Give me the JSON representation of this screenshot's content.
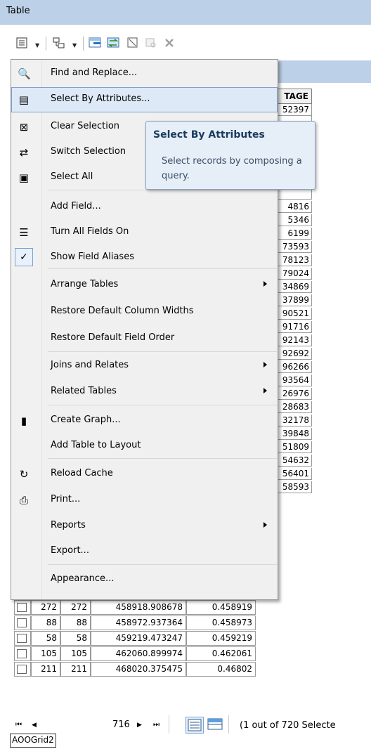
{
  "window": {
    "title": "Table"
  },
  "toolbar": {
    "icons": [
      "table-options-icon",
      "related-tables-icon",
      "select-by-attributes-icon",
      "switch-selection-icon",
      "clear-selection-icon",
      "zoom-to-selected-icon",
      "delete-selected-icon"
    ]
  },
  "table": {
    "header_partial": "TAGE",
    "partial_values": [
      "52397",
      "",
      "",
      "",
      "",
      "",
      "",
      "",
      "4816",
      "5346",
      "6199",
      "73593",
      "78123",
      "79024",
      "34869",
      "37899",
      "90521",
      "91716",
      "92143",
      "92692",
      "96266",
      "93564",
      "26976",
      "28683",
      "32178",
      "39848",
      "51809",
      "54632",
      "56401",
      "58593"
    ],
    "rows": [
      {
        "a": "272",
        "b": "272",
        "c": "458918.908678",
        "d": "0.458919"
      },
      {
        "a": "88",
        "b": "88",
        "c": "458972.937364",
        "d": "0.458973"
      },
      {
        "a": "58",
        "b": "58",
        "c": "459219.473247",
        "d": "0.459219"
      },
      {
        "a": "105",
        "b": "105",
        "c": "462060.899974",
        "d": "0.462061"
      },
      {
        "a": "211",
        "b": "211",
        "c": "468020.375475",
        "d": "0.46802"
      }
    ]
  },
  "menu": {
    "items": [
      {
        "label": "Find and Replace...",
        "icon": "binoculars-icon",
        "glyph": "🔍"
      },
      {
        "label": "Select By Attributes...",
        "icon": "select-by-attributes-icon",
        "glyph": "▤",
        "highlighted": true
      },
      {
        "label": "Clear Selection",
        "icon": "clear-selection-icon",
        "glyph": "⊠"
      },
      {
        "label": "Switch Selection",
        "icon": "switch-selection-icon",
        "glyph": "⇄"
      },
      {
        "label": "Select All",
        "icon": "select-all-icon",
        "glyph": "▣"
      },
      {
        "label": "Add Field...",
        "icon": "",
        "glyph": ""
      },
      {
        "label": "Turn All Fields On",
        "icon": "fields-icon",
        "glyph": "☰"
      },
      {
        "label": "Show Field Aliases",
        "icon": "check-icon",
        "glyph": "✓",
        "checked": true
      },
      {
        "label": "Arrange Tables",
        "submenu": true
      },
      {
        "label": "Restore Default Column Widths"
      },
      {
        "label": "Restore Default Field Order"
      },
      {
        "label": "Joins and Relates",
        "submenu": true
      },
      {
        "label": "Related Tables",
        "submenu": true
      },
      {
        "label": "Create Graph...",
        "icon": "bar-chart-icon",
        "glyph": "▮"
      },
      {
        "label": "Add Table to Layout"
      },
      {
        "label": "Reload Cache",
        "icon": "reload-icon",
        "glyph": "↻"
      },
      {
        "label": "Print...",
        "icon": "printer-icon",
        "glyph": "⎙"
      },
      {
        "label": "Reports",
        "submenu": true
      },
      {
        "label": "Export..."
      },
      {
        "label": "Appearance..."
      }
    ]
  },
  "tooltip": {
    "title": "Select By Attributes",
    "description": "Select records by composing a query."
  },
  "navigation": {
    "first": "⏮",
    "prev": "◀",
    "current": "716",
    "next": "▶",
    "last": "⏭",
    "status": "(1 out of 720 Selecte"
  },
  "tab_label": "AOOGrid2"
}
